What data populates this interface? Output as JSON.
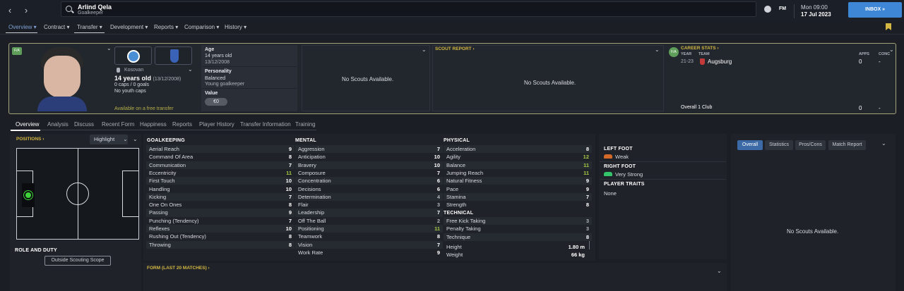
{
  "topbar": {
    "back_icon": "chevron-left-icon",
    "forward_icon": "chevron-right-icon",
    "player_name": "Arlind Qela",
    "player_position": "Goalkeeper",
    "date_line1": "Mon 09:00",
    "date_line2": "17 Jul 2023",
    "inbox_label": "INBOX",
    "fm_label": "FM"
  },
  "tabs": [
    {
      "label": "Overview"
    },
    {
      "label": "Contract"
    },
    {
      "label": "Transfer"
    },
    {
      "label": "Development"
    },
    {
      "label": "Reports"
    },
    {
      "label": "Comparison"
    },
    {
      "label": "History"
    }
  ],
  "profile": {
    "badge": "F/A",
    "nation": "Kosovan",
    "age_text": "14 years old",
    "dob_text": "(13/12/2008)",
    "caps": "0 caps / 0 goals",
    "youth_caps": "No youth caps",
    "availability": "Available on a free transfer"
  },
  "info": {
    "age_label": "Age",
    "age_value": "14 years old",
    "dob": "13/12/2008",
    "personality_label": "Personality",
    "personality_value": "Balanced",
    "personality_sub": "Young goalkeeper",
    "value_label": "Value",
    "value_amount": "€0"
  },
  "scouts_panel": {
    "text": "No Scouts Available."
  },
  "scout_report": {
    "title": "SCOUT REPORT",
    "text": "No Scouts Available."
  },
  "career": {
    "badge": "F/A",
    "title": "CAREER STATS",
    "year_header": "YEAR",
    "team_header": "TEAM",
    "apps_header": "APPS",
    "conc_header": "CONC",
    "year": "21-23",
    "team": "Augsburg",
    "apps": "0",
    "conc": "-",
    "overall_label": "Overall",
    "overall_clubs": "1 Club",
    "overall_apps": "0",
    "overall_conc": "-"
  },
  "subtabs": [
    {
      "label": "Overview"
    },
    {
      "label": "Analysis"
    },
    {
      "label": "Discuss"
    },
    {
      "label": "Recent Form"
    },
    {
      "label": "Happiness"
    },
    {
      "label": "Reports"
    },
    {
      "label": "Player History"
    },
    {
      "label": "Transfer Information"
    },
    {
      "label": "Training"
    }
  ],
  "positions": {
    "title": "POSITIONS",
    "highlight_label": "Highlight",
    "role_title": "ROLE AND DUTY",
    "outside_scope": "Outside Scouting Scope"
  },
  "attributes": {
    "goalkeeping_title": "GOALKEEPING",
    "goalkeeping": [
      {
        "name": "Aerial Reach",
        "value": "9",
        "color": "#ffffff"
      },
      {
        "name": "Command Of Area",
        "value": "8",
        "color": "#ffffff"
      },
      {
        "name": "Communication",
        "value": "7",
        "color": "#ffffff"
      },
      {
        "name": "Eccentricity",
        "value": "11",
        "color": "#a5c843"
      },
      {
        "name": "First Touch",
        "value": "10",
        "color": "#ffffff"
      },
      {
        "name": "Handling",
        "value": "10",
        "color": "#ffffff"
      },
      {
        "name": "Kicking",
        "value": "7",
        "color": "#ffffff"
      },
      {
        "name": "One On Ones",
        "value": "8",
        "color": "#ffffff"
      },
      {
        "name": "Passing",
        "value": "9",
        "color": "#ffffff"
      },
      {
        "name": "Punching (Tendency)",
        "value": "7",
        "color": "#ffffff"
      },
      {
        "name": "Reflexes",
        "value": "10",
        "color": "#ffffff"
      },
      {
        "name": "Rushing Out (Tendency)",
        "value": "8",
        "color": "#ffffff"
      },
      {
        "name": "Throwing",
        "value": "8",
        "color": "#ffffff"
      }
    ],
    "mental_title": "MENTAL",
    "mental": [
      {
        "name": "Aggression",
        "value": "7",
        "color": "#ffffff"
      },
      {
        "name": "Anticipation",
        "value": "10",
        "color": "#ffffff"
      },
      {
        "name": "Bravery",
        "value": "10",
        "color": "#ffffff"
      },
      {
        "name": "Composure",
        "value": "7",
        "color": "#ffffff"
      },
      {
        "name": "Concentration",
        "value": "6",
        "color": "#ffffff"
      },
      {
        "name": "Decisions",
        "value": "6",
        "color": "#ffffff"
      },
      {
        "name": "Determination",
        "value": "4",
        "color": "#aeb2ba"
      },
      {
        "name": "Flair",
        "value": "3",
        "color": "#aeb2ba"
      },
      {
        "name": "Leadership",
        "value": "7",
        "color": "#ffffff"
      },
      {
        "name": "Off The Ball",
        "value": "2",
        "color": "#aeb2ba"
      },
      {
        "name": "Positioning",
        "value": "11",
        "color": "#a5c843"
      },
      {
        "name": "Teamwork",
        "value": "8",
        "color": "#ffffff"
      },
      {
        "name": "Vision",
        "value": "7",
        "color": "#ffffff"
      },
      {
        "name": "Work Rate",
        "value": "9",
        "color": "#ffffff"
      }
    ],
    "physical_title": "PHYSICAL",
    "physical": [
      {
        "name": "Acceleration",
        "value": "8",
        "color": "#ffffff"
      },
      {
        "name": "Agility",
        "value": "12",
        "color": "#a5c843"
      },
      {
        "name": "Balance",
        "value": "11",
        "color": "#a5c843"
      },
      {
        "name": "Jumping Reach",
        "value": "11",
        "color": "#a5c843"
      },
      {
        "name": "Natural Fitness",
        "value": "9",
        "color": "#ffffff"
      },
      {
        "name": "Pace",
        "value": "9",
        "color": "#ffffff"
      },
      {
        "name": "Stamina",
        "value": "7",
        "color": "#ffffff"
      },
      {
        "name": "Strength",
        "value": "8",
        "color": "#ffffff"
      }
    ],
    "technical_title": "TECHNICAL",
    "technical": [
      {
        "name": "Free Kick Taking",
        "value": "3",
        "color": "#aeb2ba"
      },
      {
        "name": "Penalty Taking",
        "value": "3",
        "color": "#aeb2ba"
      },
      {
        "name": "Technique",
        "value": "8",
        "color": "#ffffff"
      }
    ],
    "height_label": "Height",
    "height_value": "1.80 m",
    "weight_label": "Weight",
    "weight_value": "66 kg"
  },
  "feet": {
    "left_title": "LEFT FOOT",
    "left_value": "Weak",
    "right_title": "RIGHT FOOT",
    "right_value": "Very Strong",
    "traits_title": "PLAYER TRAITS",
    "traits_value": "None"
  },
  "form": {
    "title": "FORM (LAST 20 MATCHES)"
  },
  "right_panel": {
    "buttons": [
      {
        "label": "Overall"
      },
      {
        "label": "Statistics"
      },
      {
        "label": "Pros/Cons"
      },
      {
        "label": "Match Report"
      }
    ],
    "text": "No Scouts Available."
  }
}
